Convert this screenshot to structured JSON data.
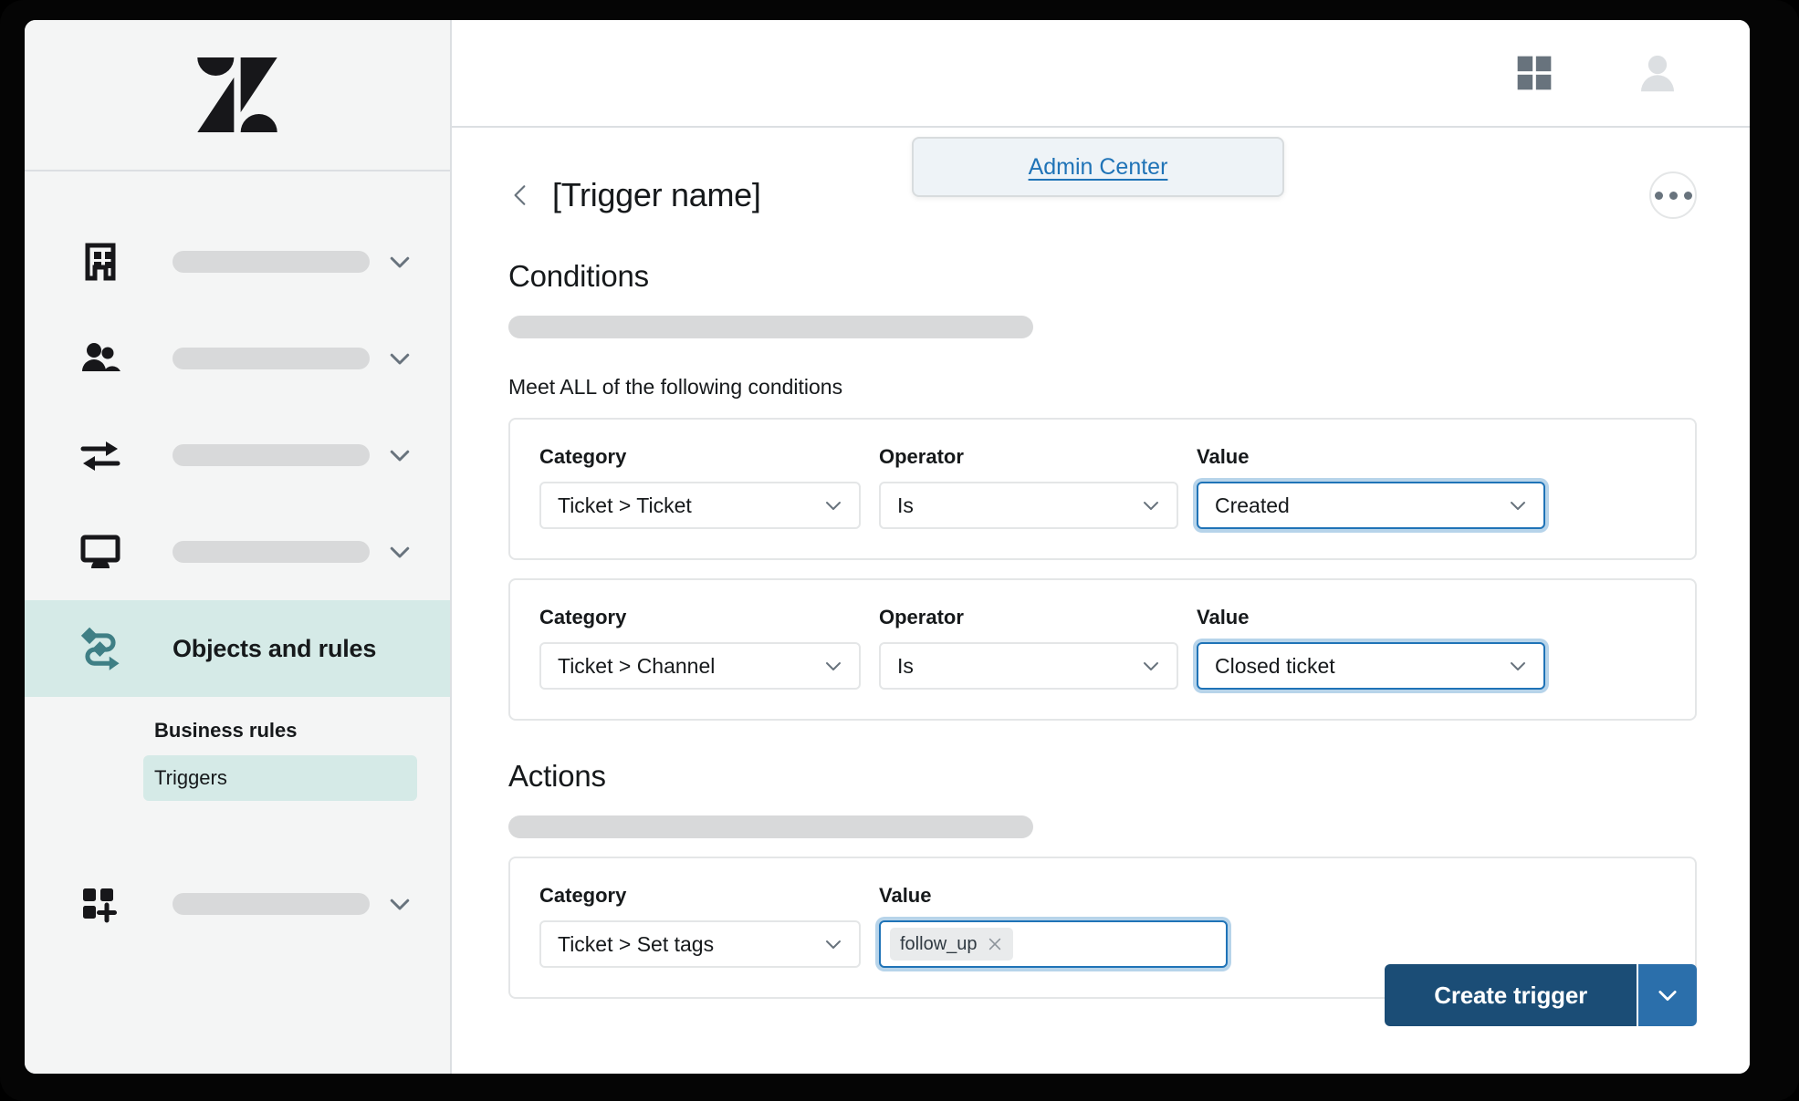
{
  "app": {
    "logo_name": "zendesk-logo"
  },
  "topbar": {
    "grid_icon": "grid-icon",
    "avatar_icon": "avatar-icon",
    "dropdown": {
      "label": "Admin Center"
    }
  },
  "sidebar": {
    "items": [
      {
        "icon": "building-icon",
        "label": "",
        "skeleton": true,
        "active": false
      },
      {
        "icon": "people-icon",
        "label": "",
        "skeleton": true,
        "active": false
      },
      {
        "icon": "two-way-arrows-icon",
        "label": "",
        "skeleton": true,
        "active": false
      },
      {
        "icon": "monitor-icon",
        "label": "",
        "skeleton": true,
        "active": false
      },
      {
        "icon": "objects-rules-icon",
        "label": "Objects and rules",
        "skeleton": false,
        "active": true
      },
      {
        "icon": "apps-add-icon",
        "label": "",
        "skeleton": true,
        "active": false
      }
    ],
    "subnav": {
      "heading": "Business rules",
      "items": [
        {
          "label": "Triggers",
          "selected": true
        }
      ]
    }
  },
  "page": {
    "back_icon": "back-chevron-icon",
    "title": "[Trigger name]",
    "kebab_icon": "more-options-icon"
  },
  "conditions": {
    "heading": "Conditions",
    "meet_all_text": "Meet ALL of the following conditions",
    "labels": {
      "category": "Category",
      "operator": "Operator",
      "value": "Value"
    },
    "rows": [
      {
        "category": "Ticket > Ticket",
        "operator": "Is",
        "value": "Created",
        "value_focused": true
      },
      {
        "category": "Ticket > Channel",
        "operator": "Is",
        "value": "Closed ticket",
        "value_focused": true
      }
    ]
  },
  "actions": {
    "heading": "Actions",
    "labels": {
      "category": "Category",
      "value": "Value"
    },
    "rows": [
      {
        "category": "Ticket > Set tags",
        "tags": [
          {
            "label": "follow_up",
            "remove_icon": "remove-tag-icon"
          }
        ]
      }
    ]
  },
  "footer": {
    "primary_label": "Create trigger",
    "split_icon": "chevron-down-icon"
  },
  "colors": {
    "accent_teal": "#d5eae7",
    "link_blue": "#1f73b7",
    "primary_navy": "#1b4d76",
    "primary_split_blue": "#2b6fab",
    "focus_ring": "#b7d4ea"
  }
}
